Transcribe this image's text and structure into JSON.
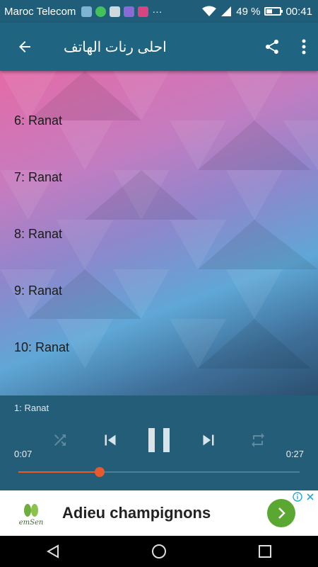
{
  "status_bar": {
    "carrier": "Maroc Telecom",
    "battery": "49 %",
    "battery_level": 0.49,
    "time": "00:41",
    "notification_icons": [
      "gallery-icon",
      "whatsapp-icon",
      "mail-icon",
      "app-icon",
      "instagram-icon",
      "more-notifications-icon"
    ]
  },
  "app_bar": {
    "title": "احلى رنات الهاتف"
  },
  "tracks": [
    {
      "label": "6: Ranat"
    },
    {
      "label": "7: Ranat"
    },
    {
      "label": "8: Ranat"
    },
    {
      "label": "9: Ranat"
    },
    {
      "label": "10: Ranat"
    }
  ],
  "player": {
    "now_playing": "1: Ranat",
    "elapsed": "0:07",
    "duration": "0:27",
    "progress": 0.29,
    "accent_color": "#e65a2e"
  },
  "ad": {
    "brand": "emSen",
    "headline": "Adieu champignons"
  }
}
